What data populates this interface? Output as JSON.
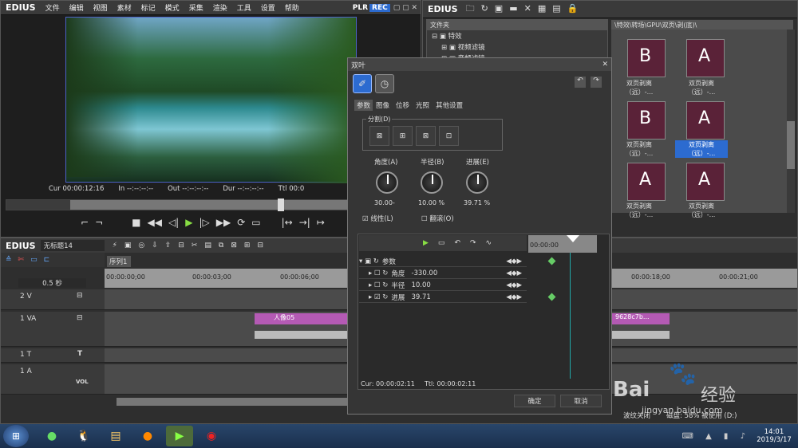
{
  "app": {
    "logo": "EDIUS",
    "menus": [
      "文件",
      "编辑",
      "视图",
      "素材",
      "标记",
      "模式",
      "采集",
      "渲染",
      "工具",
      "设置",
      "帮助"
    ],
    "plr": "PLR",
    "rec": "REC"
  },
  "player": {
    "cur": "Cur 00:00:12:16",
    "in": "In --:--:--:--",
    "out": "Out --:--:--:--",
    "dur": "Dur --:--:--:--",
    "ttl": "Ttl 00:0"
  },
  "bin": {
    "logo": "EDIUS",
    "folder_label": "文件夹",
    "tree": [
      "特效",
      "视频滤镜",
      "音频滤镜"
    ],
    "path": "\\特效\\转场\\GPU\\双页\\剥(底)\\",
    "thumbs": [
      "双页剥离（远）-...",
      "双页剥离（远）-...",
      "双页剥离（远）-...",
      "双页剥离（远）-...",
      "双页剥离（远）-...",
      "双页剥离（远）-..."
    ]
  },
  "dialog": {
    "title": "双叶",
    "tabs": [
      "参数",
      "图像",
      "位移",
      "光照",
      "其他设置"
    ],
    "split_label": "分割(D)",
    "angle_label": "角度(A)",
    "radius_label": "半径(B)",
    "progress_label": "进展(E)",
    "angle_val": "30.00-",
    "radius_val": "10.00 %",
    "progress_val": "39.71 %",
    "linear": "线性(L)",
    "reverse": "翻滚(O)",
    "kf_params": "参数",
    "kf_angle": "角度",
    "kf_angle_v": "-330.00",
    "kf_radius": "半径",
    "kf_radius_v": "10.00",
    "kf_prog": "进展",
    "kf_prog_v": "39.71",
    "kf_time": "00:00:00",
    "cur": "Cur: 00:00:02:11",
    "ttl": "Ttl: 00:00:02:11",
    "ok": "确定",
    "cancel": "取消"
  },
  "timeline": {
    "logo": "EDIUS",
    "project": "无标题14",
    "seq_tab": "序列1",
    "zoom": "0.5 秒",
    "times": [
      "00:00:00;00",
      "00:00:03;00",
      "00:00:06;00",
      "00:00:18;00",
      "00:00:21;00"
    ],
    "tracks": [
      "2 V",
      "1 VA",
      "1 T",
      "1 A"
    ],
    "clip1": "人像05",
    "clip2": "9628c7b...",
    "vol": "VOL"
  },
  "status": {
    "text": "波纹关闭",
    "disk": "磁盘: 58% 被使用 (D:)"
  },
  "taskbar": {
    "time": "14:01",
    "date": "2019/3/17"
  },
  "watermark": {
    "brand": "Bai",
    "sub": "jingyan.baidu.com",
    "jingyan": "经验"
  }
}
